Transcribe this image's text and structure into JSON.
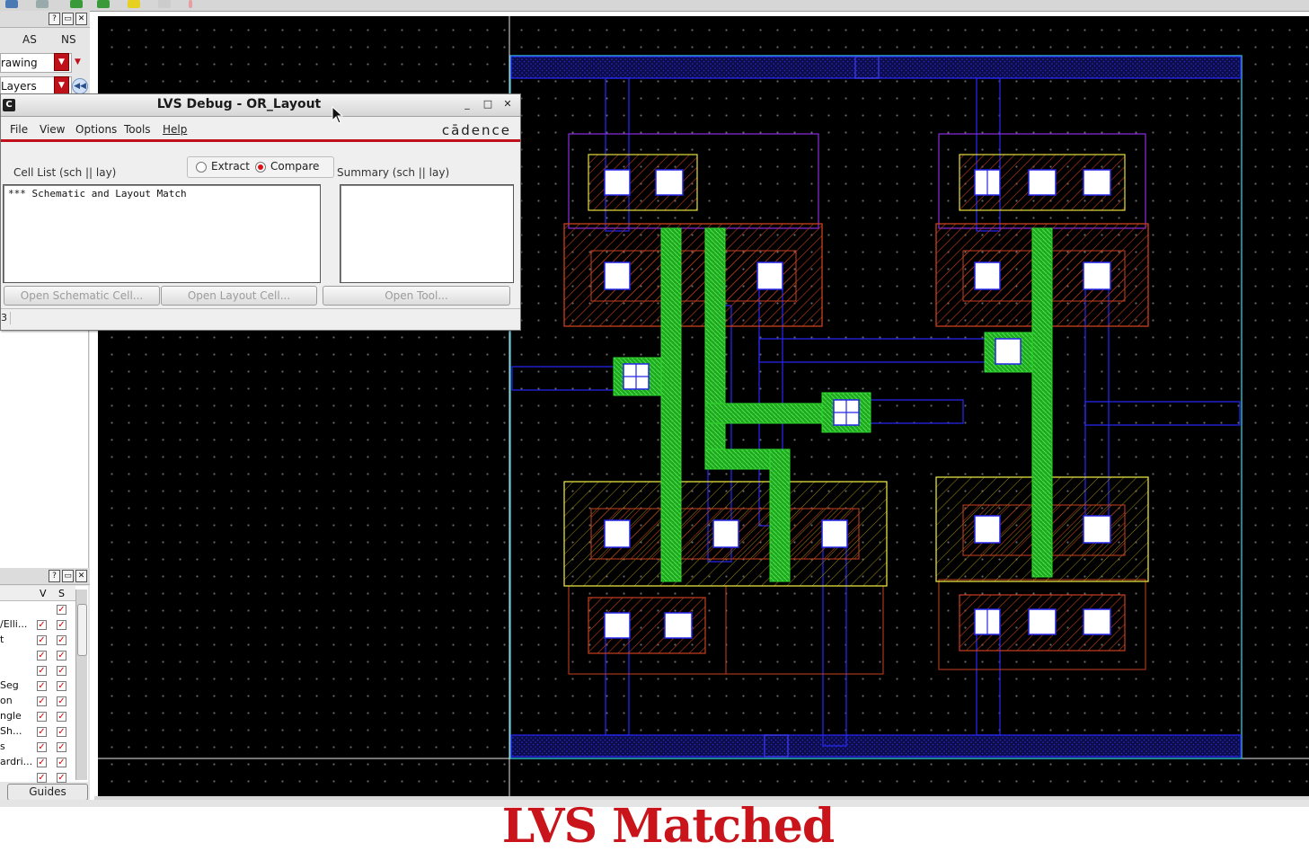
{
  "left_panel": {
    "col_as": "AS",
    "col_ns": "NS",
    "purpose_combo": "rawing",
    "layers_combo": "Layers",
    "objects": {
      "col_v": "V",
      "col_s": "S",
      "rows": [
        "",
        "/Elli...",
        "t",
        "",
        "",
        "Seg",
        "on",
        "ngle",
        "Sh...",
        "s",
        "ardri...",
        ""
      ]
    },
    "guides_button": "Guides"
  },
  "dialog": {
    "title": "LVS Debug - OR_Layout",
    "app_icon": "C",
    "menus": [
      "File",
      "View",
      "Options",
      "Tools",
      "Help"
    ],
    "brand": "cādence",
    "mode_extract": "Extract",
    "mode_compare": "Compare",
    "selected_mode": "Compare",
    "cell_list_label": "Cell List (sch || lay)",
    "summary_label": "Summary (sch || lay)",
    "cell_list_text": "*** Schematic and Layout Match",
    "btn_open_schematic": "Open Schematic Cell...",
    "btn_open_layout": "Open Layout Cell...",
    "btn_open_tool": "Open Tool...",
    "status_num": "3"
  },
  "banner": {
    "text": "LVS Matched"
  },
  "colors": {
    "banner_red": "#c8141a",
    "metal1": "#2020e0",
    "poly": "#2ed82e",
    "diffusion": "#c84020",
    "nwell_outline": "#8a2be2",
    "implant_outline": "#e6e040",
    "boundary": "#33c8e0",
    "canvas_bg": "#000000"
  },
  "icons": {
    "window_minimize": "minimize-icon",
    "window_maximize": "maximize-icon",
    "window_close": "close-icon",
    "help": "help-icon",
    "float": "float-icon"
  }
}
